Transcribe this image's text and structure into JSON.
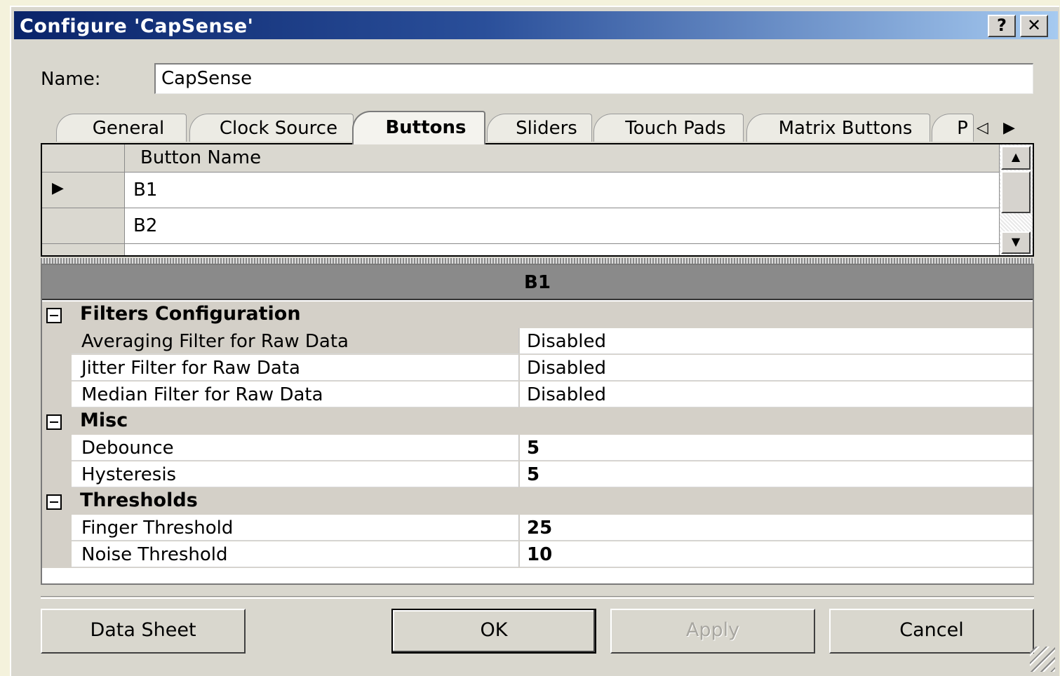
{
  "window": {
    "title": "Configure 'CapSense'",
    "help_label": "?",
    "close_label": "✕"
  },
  "name_field": {
    "label": "Name:",
    "value": "CapSense"
  },
  "tabs": [
    {
      "label": "General",
      "active": false
    },
    {
      "label": "Clock Source",
      "active": false
    },
    {
      "label": "Buttons",
      "active": true
    },
    {
      "label": "Sliders",
      "active": false
    },
    {
      "label": "Touch Pads",
      "active": false
    },
    {
      "label": "Matrix Buttons",
      "active": false
    },
    {
      "label": "P",
      "active": false
    }
  ],
  "tab_scroll": {
    "left": "◁",
    "right": "▶"
  },
  "button_grid": {
    "column_header": "Button Name",
    "rows": [
      {
        "name": "B1",
        "current": true,
        "marker": "▶"
      },
      {
        "name": "B2",
        "current": false
      }
    ],
    "scroll_up": "▲",
    "scroll_down": "▼"
  },
  "properties": {
    "title": "B1",
    "categories": [
      {
        "name": "Filters Configuration",
        "items": [
          {
            "name": "Averaging Filter for Raw Data",
            "value": "Disabled"
          },
          {
            "name": "Jitter Filter for Raw Data",
            "value": "Disabled"
          },
          {
            "name": "Median Filter for Raw Data",
            "value": "Disabled"
          }
        ]
      },
      {
        "name": "Misc",
        "items": [
          {
            "name": "Debounce",
            "value": "5"
          },
          {
            "name": "Hysteresis",
            "value": "5"
          }
        ]
      },
      {
        "name": "Thresholds",
        "items": [
          {
            "name": "Finger Threshold",
            "value": "25"
          },
          {
            "name": "Noise Threshold",
            "value": "10"
          }
        ]
      }
    ]
  },
  "buttons": {
    "data_sheet": "Data Sheet",
    "ok": "OK",
    "apply": "Apply",
    "cancel": "Cancel"
  },
  "colors": {
    "titlebar_start": "#0a246a",
    "titlebar_end": "#a6caf0",
    "dialog_bg": "#d9d7ce"
  }
}
